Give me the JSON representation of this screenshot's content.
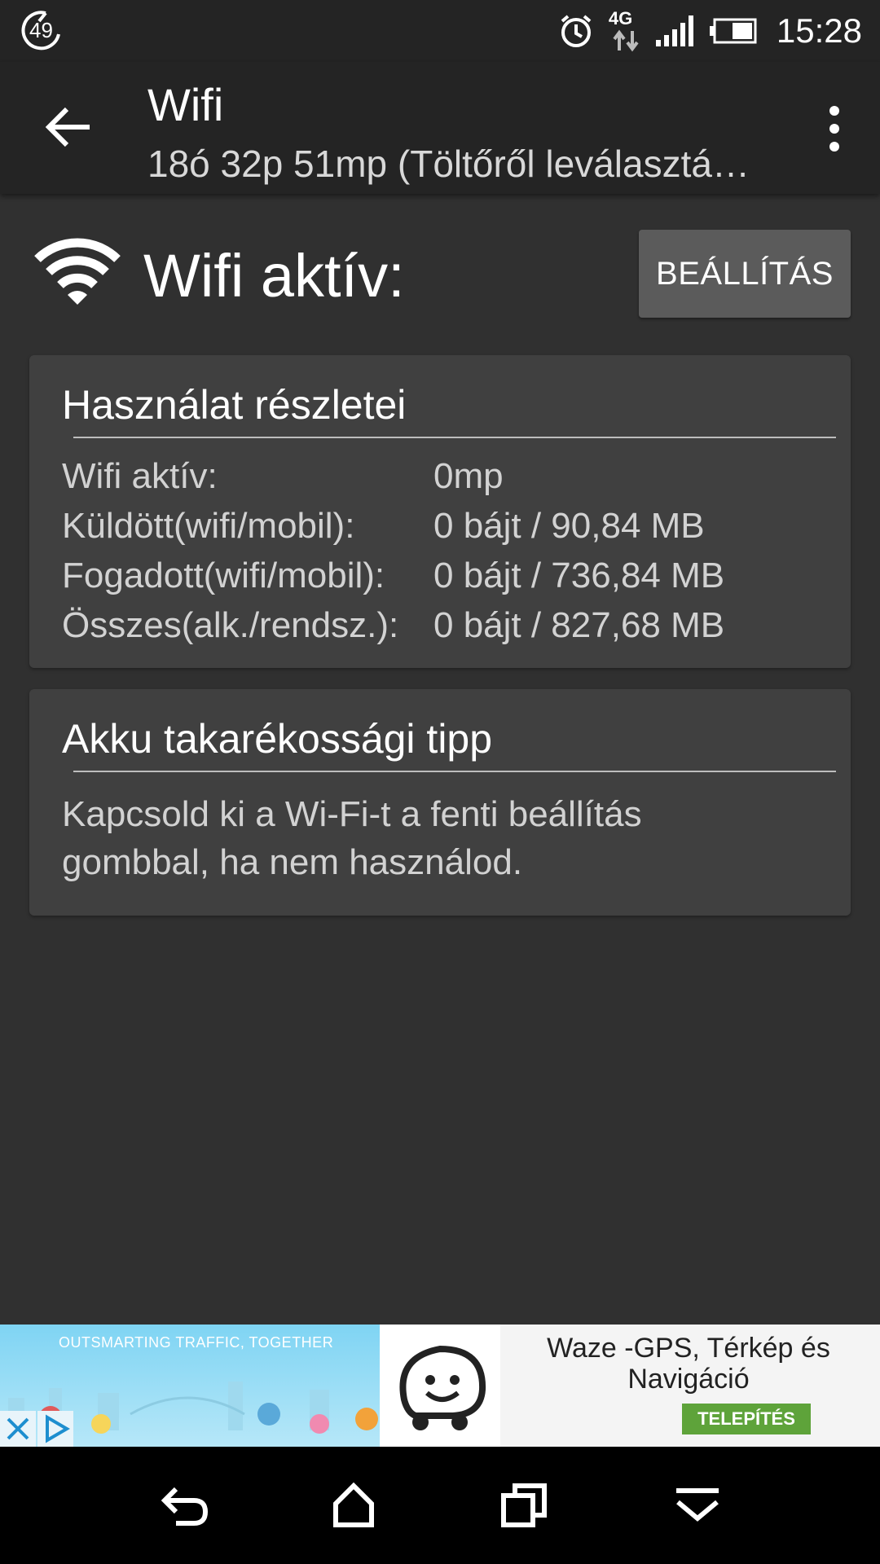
{
  "status_bar": {
    "badge_number": "49",
    "network_type": "4G",
    "time": "15:28"
  },
  "app_bar": {
    "title": "Wifi",
    "subtitle": "18ó 32p 51mp (Töltőről leválasztá…"
  },
  "header": {
    "heading": "Wifi aktív:",
    "settings_button": "BEÁLLÍTÁS"
  },
  "usage_card": {
    "title": "Használat részletei",
    "rows": [
      {
        "label": "Wifi aktív:",
        "value": "0mp"
      },
      {
        "label": "Küldött(wifi/mobil):",
        "value": "0 bájt / 90,84 MB"
      },
      {
        "label": "Fogadott(wifi/mobil):",
        "value": "0 bájt / 736,84 MB"
      },
      {
        "label": "Összes(alk./rendsz.):",
        "value": "0 bájt / 827,68 MB"
      }
    ]
  },
  "tip_card": {
    "title": "Akku takarékossági tipp",
    "text": "Kapcsold ki a Wi-Fi-t a fenti beállítás gombbal, ha nem használod."
  },
  "ad": {
    "slogan": "OUTSMARTING TRAFFIC, TOGETHER",
    "title": "Waze -GPS, Térkép és Navigáció",
    "install_label": "TELEPÍTÉS",
    "install_color": "#5ea33a"
  },
  "icons": {
    "back": "arrow-left-icon",
    "overflow": "more-vert-icon",
    "wifi": "wifi-icon",
    "alarm": "alarm-icon",
    "signal": "signal-icon",
    "battery": "battery-icon"
  }
}
